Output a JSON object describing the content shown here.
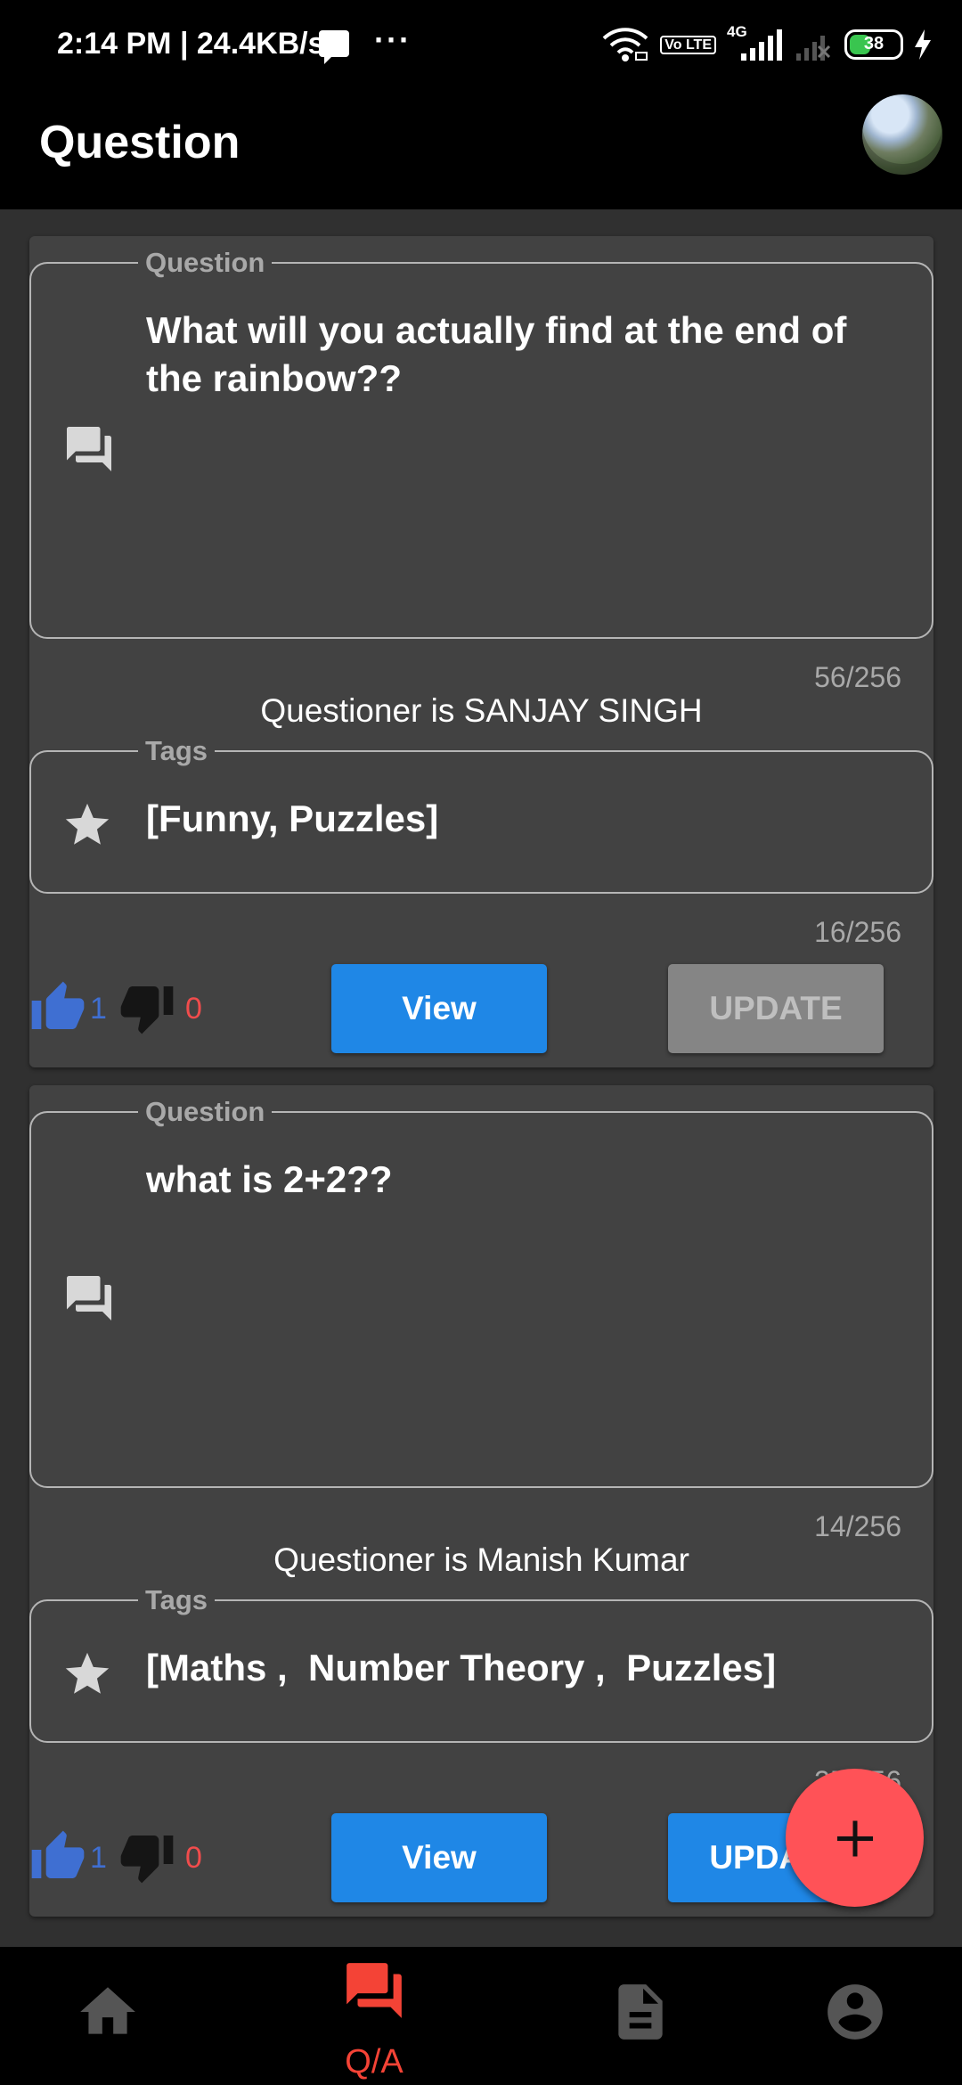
{
  "status_bar": {
    "time": "2:14 PM | 24.4KB/s",
    "dots": "···",
    "network_badge": "Vo LTE",
    "network_type": "4G",
    "battery": "38"
  },
  "app_bar": {
    "title": "Question"
  },
  "questions": [
    {
      "question_label": "Question",
      "question": "What will you actually find at the end of the rainbow??",
      "question_count": "56/256",
      "questioner": "Questioner is SANJAY SINGH",
      "tags_label": "Tags",
      "tags": "[Funny, Puzzles]",
      "tags_count": "16/256",
      "likes": "1",
      "dislikes": "0",
      "view_label": "View",
      "update_label": "UPDATE"
    },
    {
      "question_label": "Question",
      "question": "what is 2+2??",
      "question_count": "14/256",
      "questioner": "Questioner is Manish Kumar",
      "tags_label": "Tags",
      "tags": "[Maths ,  Number Theory ,  Puzzles]",
      "tags_count": "35/256",
      "likes": "1",
      "dislikes": "0",
      "view_label": "View",
      "update_label": "UPDATE"
    }
  ],
  "bottom_nav": {
    "items": [
      {
        "icon": "home-icon",
        "label": ""
      },
      {
        "icon": "forum-icon",
        "label": "Q/A"
      },
      {
        "icon": "document-icon",
        "label": ""
      },
      {
        "icon": "account-icon",
        "label": ""
      }
    ]
  },
  "colors": {
    "background": "#303030",
    "card": "#424242",
    "accent": "#1f87e6",
    "danger": "#f44336"
  }
}
